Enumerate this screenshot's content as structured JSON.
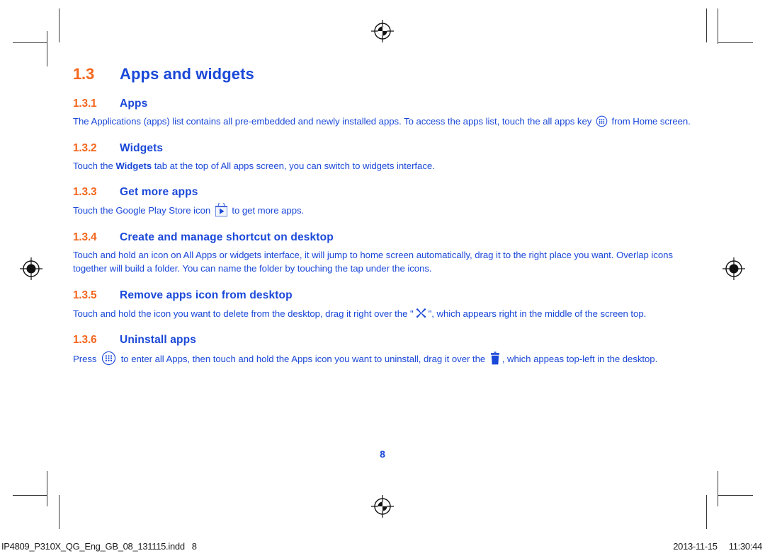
{
  "document": {
    "page_number": "8",
    "chapter": {
      "number": "1.3",
      "title": "Apps and widgets"
    },
    "sections": [
      {
        "number": "1.3.1",
        "title": "Apps",
        "body_pre": "The Applications (apps) list contains all pre-embedded and newly installed apps. To access the apps list, touch the all apps key ",
        "icon": "all-apps-icon",
        "body_post": " from Home screen."
      },
      {
        "number": "1.3.2",
        "title": "Widgets",
        "body_pre": "Touch the ",
        "bold": "Widgets",
        "body_post": " tab at the top of All apps screen, you can switch to widgets interface."
      },
      {
        "number": "1.3.3",
        "title": "Get more apps",
        "body_pre": "Touch the Google Play Store icon ",
        "icon": "google-play-store-icon",
        "body_post": " to get more apps."
      },
      {
        "number": "1.3.4",
        "title": "Create and manage shortcut on desktop",
        "body_pre": "Touch and hold an icon on All Apps or widgets interface, it will jump to home screen automatically, drag it to the right place you want. Overlap icons together will build a folder. You can name the folder by touching the tap under the icons."
      },
      {
        "number": "1.3.5",
        "title": "Remove apps icon from desktop",
        "body_pre": "Touch and hold the icon you want to delete from the desktop, drag it right over the \"",
        "icon": "remove-x-icon",
        "body_post": "\", which appears right in the middle of the screen top."
      },
      {
        "number": "1.3.6",
        "title": "Uninstall apps",
        "body_pre": "Press ",
        "icon": "all-apps-icon",
        "body_mid": " to enter all Apps, then touch and hold the Apps icon you want to uninstall, drag it over the ",
        "icon2": "trash-can-icon",
        "body_post": ", which appeas top-left in the desktop."
      }
    ]
  },
  "footer": {
    "filename": "IP4809_P310X_QG_Eng_GB_08_131115.indd",
    "page": "8",
    "date": "2013-11-15",
    "time": "11:30:44"
  },
  "colors": {
    "heading_number": "#f4661e",
    "heading_title": "#1a48d8",
    "body_text": "#1a48d8",
    "crop_mark": "#3a3a3a",
    "footer_text": "#1c1c1c"
  },
  "print_marks": {
    "registration_mark_name": "registration-target-mark",
    "crop_mark_name": "crop-mark"
  }
}
